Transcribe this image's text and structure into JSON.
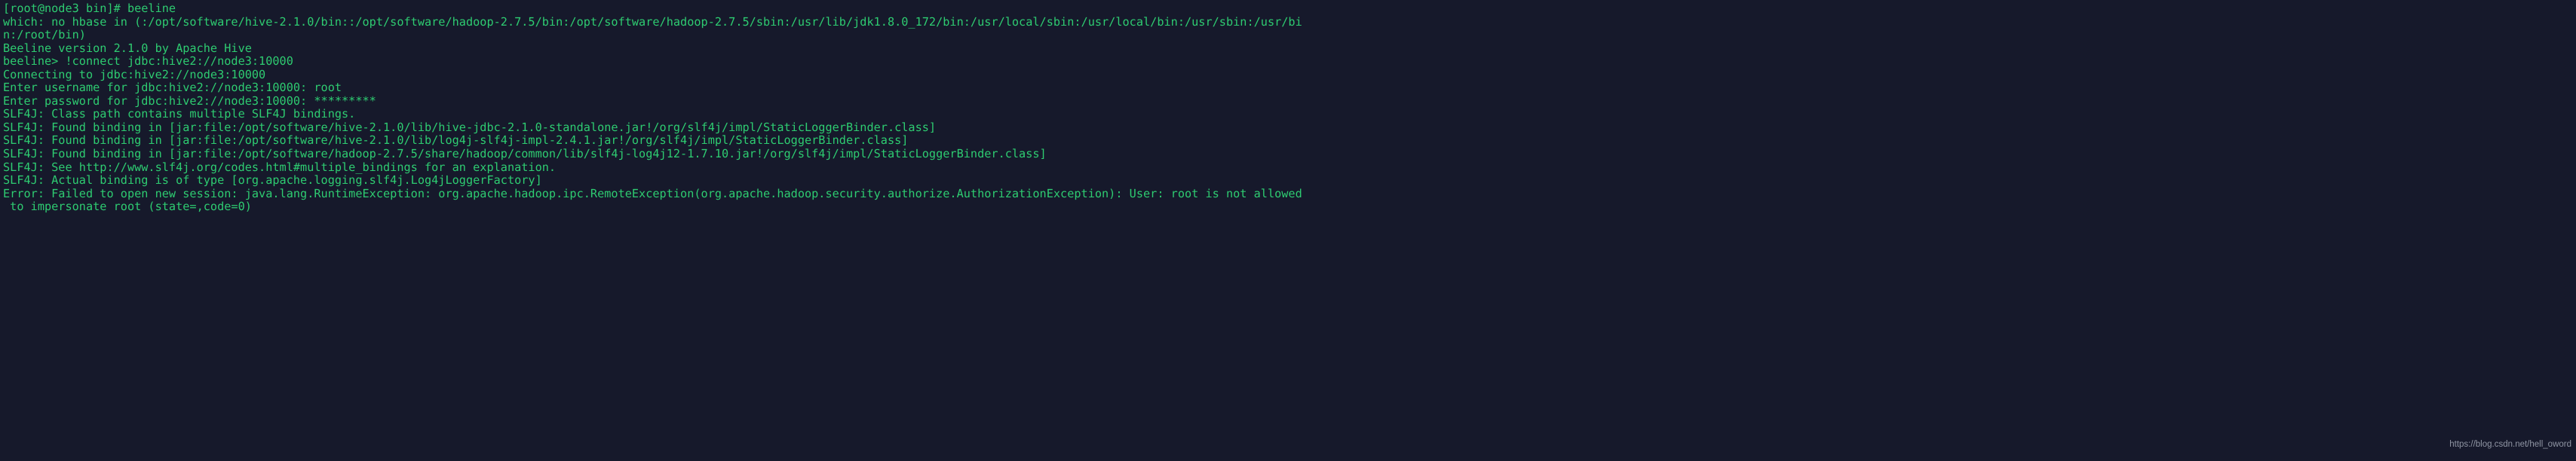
{
  "terminal": {
    "background_color": "#16192b",
    "text_color": "#2ecc71",
    "prompt": "[root@node3 bin]#",
    "lines": [
      "[root@node3 bin]# beeline",
      "which: no hbase in (:/opt/software/hive-2.1.0/bin::/opt/software/hadoop-2.7.5/bin:/opt/software/hadoop-2.7.5/sbin:/usr/lib/jdk1.8.0_172/bin:/usr/local/sbin:/usr/local/bin:/usr/sbin:/usr/bi",
      "n:/root/bin)",
      "Beeline version 2.1.0 by Apache Hive",
      "beeline> !connect jdbc:hive2://node3:10000",
      "Connecting to jdbc:hive2://node3:10000",
      "Enter username for jdbc:hive2://node3:10000: root",
      "Enter password for jdbc:hive2://node3:10000: *********",
      "SLF4J: Class path contains multiple SLF4J bindings.",
      "SLF4J: Found binding in [jar:file:/opt/software/hive-2.1.0/lib/hive-jdbc-2.1.0-standalone.jar!/org/slf4j/impl/StaticLoggerBinder.class]",
      "SLF4J: Found binding in [jar:file:/opt/software/hive-2.1.0/lib/log4j-slf4j-impl-2.4.1.jar!/org/slf4j/impl/StaticLoggerBinder.class]",
      "SLF4J: Found binding in [jar:file:/opt/software/hadoop-2.7.5/share/hadoop/common/lib/slf4j-log4j12-1.7.10.jar!/org/slf4j/impl/StaticLoggerBinder.class]",
      "SLF4J: See http://www.slf4j.org/codes.html#multiple_bindings for an explanation.",
      "SLF4J: Actual binding is of type [org.apache.logging.slf4j.Log4jLoggerFactory]",
      "Error: Failed to open new session: java.lang.RuntimeException: org.apache.hadoop.ipc.RemoteException(org.apache.hadoop.security.authorize.AuthorizationException): User: root is not allowed",
      " to impersonate root (state=,code=0)"
    ]
  },
  "watermark": {
    "text": "https://blog.csdn.net/hell_oword",
    "color": "#9aa0ae"
  }
}
